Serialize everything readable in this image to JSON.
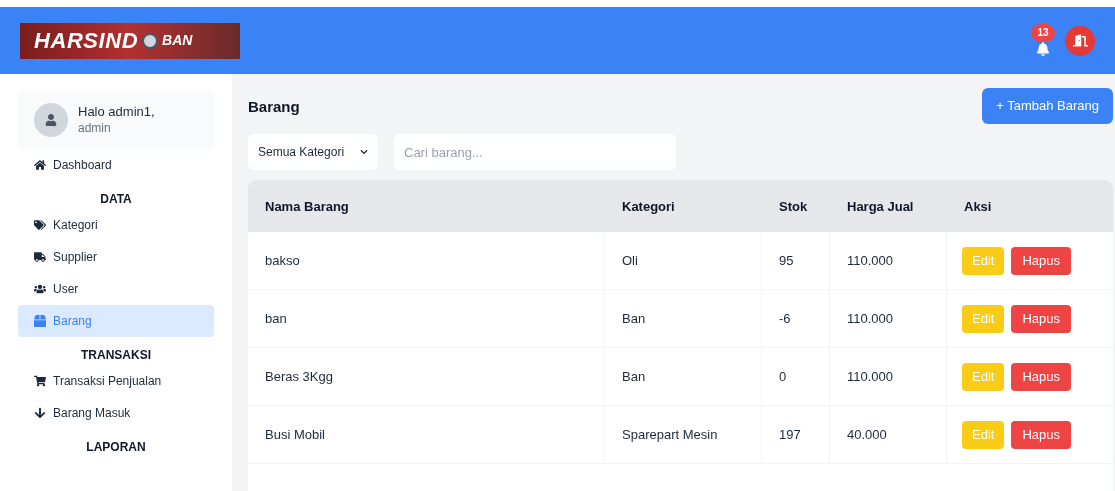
{
  "header": {
    "logo": {
      "word1": "HARSIND",
      "word2": "BAN"
    },
    "notification_count": "13"
  },
  "sidebar": {
    "user": {
      "greeting": "Halo admin1,",
      "role": "admin"
    },
    "items": [
      {
        "kind": "link",
        "label": "Dashboard",
        "selected": false
      },
      {
        "kind": "section",
        "label": "DATA"
      },
      {
        "kind": "link",
        "label": "Kategori",
        "selected": false
      },
      {
        "kind": "link",
        "label": "Supplier",
        "selected": false
      },
      {
        "kind": "link",
        "label": "User",
        "selected": false
      },
      {
        "kind": "link",
        "label": "Barang",
        "selected": true
      },
      {
        "kind": "section",
        "label": "TRANSAKSI"
      },
      {
        "kind": "link",
        "label": "Transaksi Penjualan",
        "selected": false
      },
      {
        "kind": "link",
        "label": "Barang Masuk",
        "selected": false
      },
      {
        "kind": "section",
        "label": "LAPORAN"
      }
    ]
  },
  "main": {
    "title": "Barang",
    "add_button": "+ Tambah Barang",
    "filter": {
      "value": "Semua Kategori"
    },
    "search": {
      "placeholder": "Cari barang..."
    },
    "table": {
      "columns": [
        "Nama Barang",
        "Kategori",
        "Stok",
        "Harga Jual",
        "Aksi"
      ],
      "rows": [
        {
          "name": "bakso",
          "category": "Oli",
          "stock": "95",
          "price": "110.000",
          "edit": "Edit",
          "delete": "Hapus"
        },
        {
          "name": "ban",
          "category": "Ban",
          "stock": "-6",
          "price": "110.000",
          "edit": "Edit",
          "delete": "Hapus"
        },
        {
          "name": "Beras 3Kgg",
          "category": "Ban",
          "stock": "0",
          "price": "110.000",
          "edit": "Edit",
          "delete": "Hapus"
        },
        {
          "name": "Busi Mobil",
          "category": "Sparepart Mesin",
          "stock": "197",
          "price": "40.000",
          "edit": "Edit",
          "delete": "Hapus"
        }
      ]
    }
  }
}
